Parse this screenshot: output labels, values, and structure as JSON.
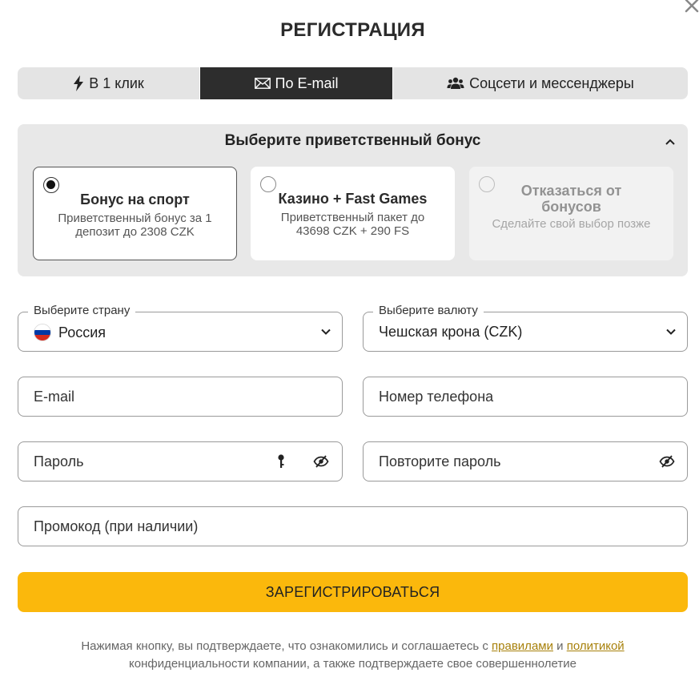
{
  "title": "РЕГИСТРАЦИЯ",
  "tabs": [
    {
      "label": "В 1 клик",
      "icon": "lightning-icon"
    },
    {
      "label": "По E-mail",
      "icon": "envelope-icon",
      "active": true
    },
    {
      "label": "Соцсети и мессенджеры",
      "icon": "users-icon"
    }
  ],
  "bonus": {
    "title": "Выберите приветственный бонус",
    "options": [
      {
        "title": "Бонус на спорт",
        "subtitle": "Приветственный бонус за 1 депозит до 2308 CZK",
        "selected": true
      },
      {
        "title": "Казино + Fast Games",
        "subtitle": "Приветственный пакет до 43698 CZK + 290 FS",
        "selected": false
      },
      {
        "title": "Отказаться от бонусов",
        "subtitle": "Сделайте свой выбор позже",
        "selected": false
      }
    ]
  },
  "form": {
    "country": {
      "label": "Выберите страну",
      "value": "Россия",
      "flag": "russia-flag"
    },
    "currency": {
      "label": "Выберите валюту",
      "value": "Чешская крона (CZK)"
    },
    "email_placeholder": "E-mail",
    "phone_placeholder": "Номер телефона",
    "password_placeholder": "Пароль",
    "password_repeat_placeholder": "Повторите пароль",
    "promo_placeholder": "Промокод (при наличии)"
  },
  "submit_label": "ЗАРЕГИСТРИРОВАТЬСЯ",
  "legal": {
    "text_1": "Нажимая кнопку, вы подтверждаете, что ознакомились и соглашаетесь с ",
    "link_rules": "правилами",
    "and": " и ",
    "link_policy": "политикой",
    "text_2": "конфиденциальности компании, а также подтверждаете свое совершеннолетие"
  },
  "colors": {
    "accent": "#fbb80c",
    "active_tab": "#2d2d2d",
    "link": "#a7800a"
  }
}
